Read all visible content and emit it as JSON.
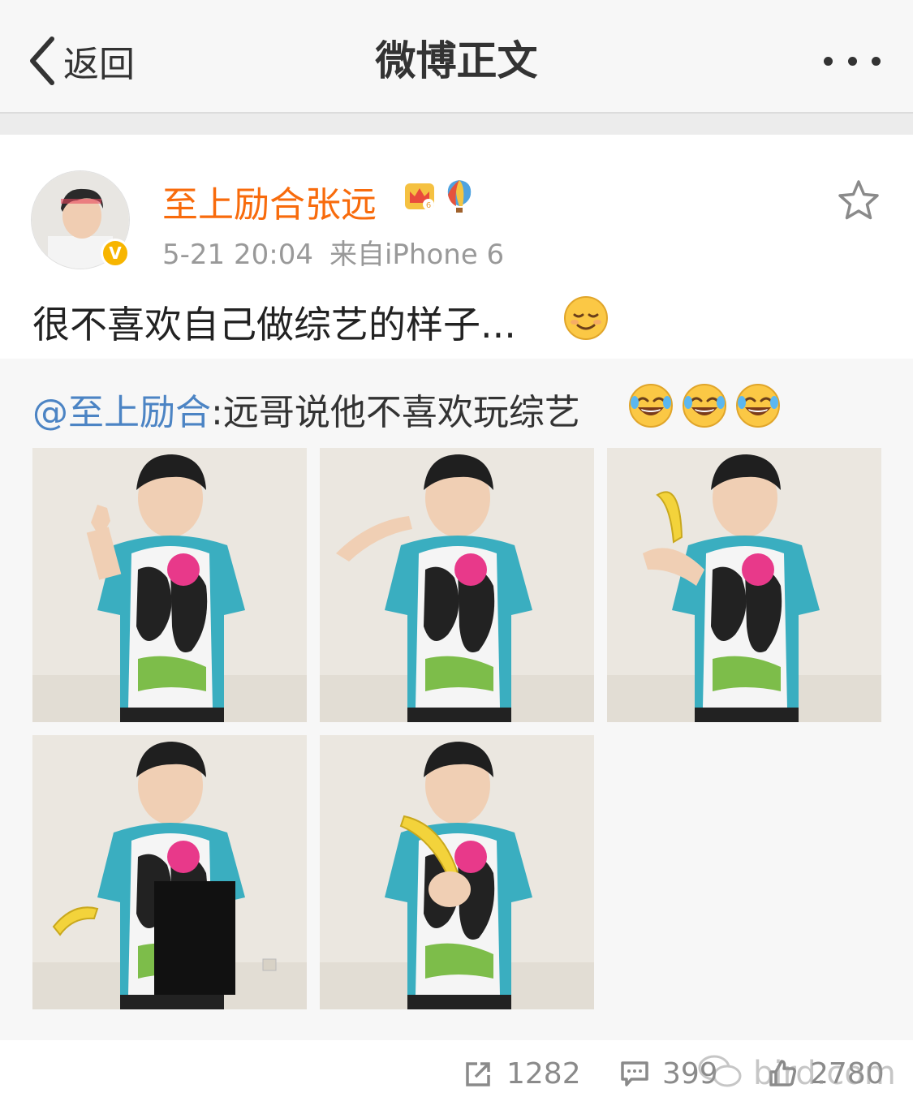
{
  "nav": {
    "back_label": "返回",
    "title": "微博正文"
  },
  "post": {
    "username": "至上励合张远",
    "time": "5-21 20:04",
    "source": "来自iPhone 6",
    "text": "很不喜欢自己做综艺的样子..."
  },
  "repost": {
    "mention": "@至上励合",
    "text": ":远哥说他不喜欢玩综艺",
    "image_count": 5
  },
  "actions": {
    "repost_count": "1282",
    "comment_count": "399",
    "like_count": "2780"
  },
  "watermark": "bird.com",
  "colors": {
    "username": "#f86b0c",
    "mention": "#4c84c4",
    "verified": "#f7b500"
  },
  "icons": [
    "back-chevron-icon",
    "more-icon",
    "star-icon",
    "crown-badge-icon",
    "balloon-icon",
    "relaxed-face-emoji",
    "laughing-tears-emoji",
    "repost-icon",
    "comment-icon",
    "like-icon"
  ]
}
